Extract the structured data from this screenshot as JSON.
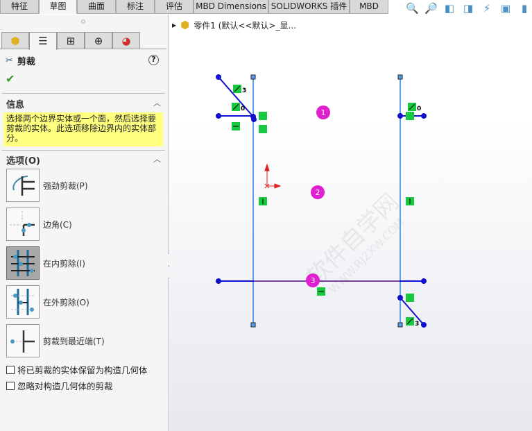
{
  "ribbon": {
    "tabs": [
      "特征",
      "草图",
      "曲面",
      "标注",
      "评估",
      "MBD Dimensions",
      "SOLIDWORKS 插件",
      "MBD"
    ],
    "active": 1
  },
  "toolbar": {
    "icons": [
      "zoom-to-fit-icon",
      "zoom-area-icon",
      "previous-view-icon",
      "section-view-icon",
      "dynamic-annotation-icon",
      "view-orientation-icon",
      "display-style-icon"
    ]
  },
  "panel": {
    "tabs": [
      "feature-manager-icon",
      "property-manager-icon",
      "configuration-manager-icon",
      "dimxpert-icon",
      "appearance-icon"
    ],
    "title": "剪裁",
    "help": "?",
    "ok": "✔",
    "info_header": "信息",
    "info_text": "选择两个边界实体或一个面，然后选择要剪裁的实体。此选项移除边界内的实体部分。",
    "options_header": "选项(O)",
    "options": [
      {
        "label": "强劲剪裁(P)",
        "active": false
      },
      {
        "label": "边角(C)",
        "active": false
      },
      {
        "label": "在内剪除(I)",
        "active": true
      },
      {
        "label": "在外剪除(O)",
        "active": false
      },
      {
        "label": "剪裁到最近端(T)",
        "active": false
      }
    ],
    "checkboxes": [
      {
        "label": "将已剪裁的实体保留为构造几何体",
        "checked": false
      },
      {
        "label": "忽略对构造几何体的剪裁",
        "checked": false
      }
    ]
  },
  "tree": {
    "label": "零件1  (默认<<默认>_显..."
  },
  "sketch": {
    "balloons": [
      "1",
      "2",
      "3"
    ],
    "relation_labels": [
      "3",
      "0",
      "0",
      "3"
    ],
    "colors": {
      "line": "#1010d0",
      "selected": "#5aa0f0",
      "balloon": "#e020d0",
      "relation": "#18c840"
    }
  },
  "watermark": "软件自学网 WWW.RJZXW.COM"
}
